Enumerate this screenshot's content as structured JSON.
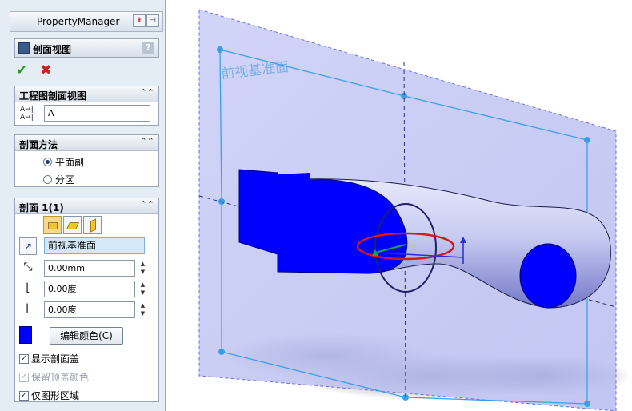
{
  "panel": {
    "title": "PropertyManager",
    "section_view": {
      "title": "剖面视图",
      "help": "?"
    },
    "actions": {
      "ok": "✔",
      "cancel": "✖"
    },
    "label_group": {
      "title": "工程图剖面视图",
      "label_icon": "A→|\nA→|",
      "label_value": "A"
    },
    "method_group": {
      "title": "剖面方法",
      "options": [
        {
          "label": "平面副",
          "selected": true
        },
        {
          "label": "分区",
          "selected": false
        }
      ]
    },
    "section1": {
      "title": "剖面 1(1)",
      "plane_value": "前视基准面",
      "offset": "0.00mm",
      "angle_x": "0.00度",
      "angle_y": "0.00度",
      "edit_color": "编辑颜色(C)",
      "section_color": "#0000ff",
      "checkboxes": [
        {
          "label": "显示剖面盖",
          "checked": true,
          "enabled": true
        },
        {
          "label": "保留顶盖颜色",
          "checked": true,
          "enabled": false
        },
        {
          "label": "仅图形区域",
          "checked": true,
          "enabled": true
        }
      ]
    }
  },
  "viewport": {
    "plane_label": "前视基准面",
    "plane_color": "#c3c8f3",
    "section_color": "#0000ff"
  }
}
